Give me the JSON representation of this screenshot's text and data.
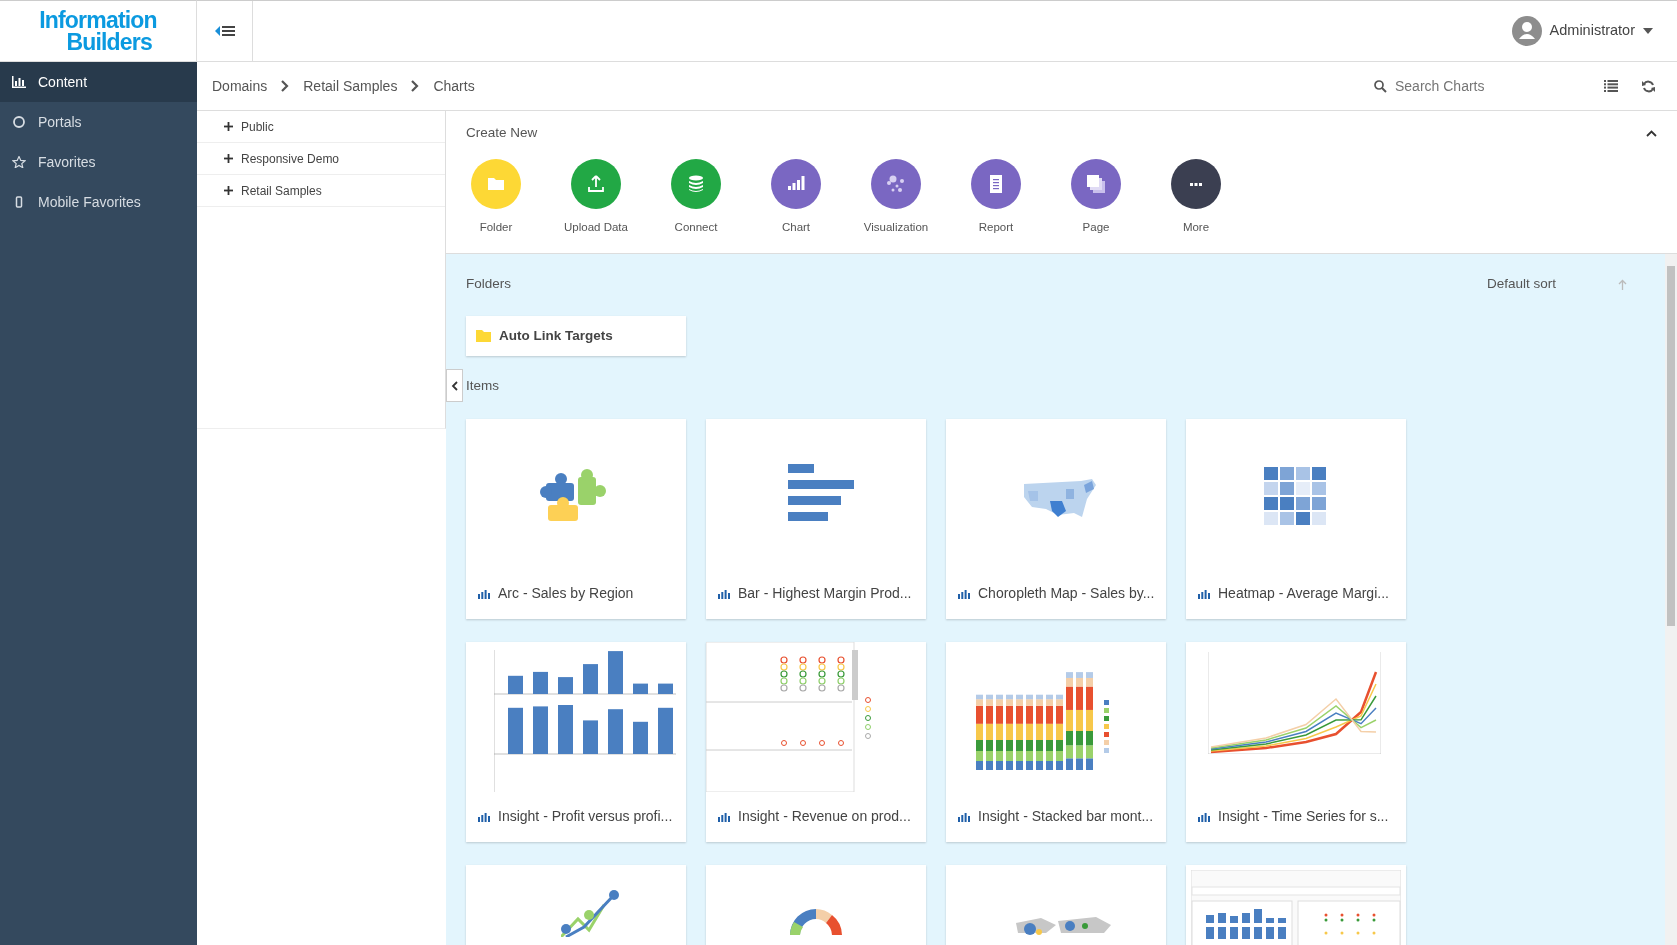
{
  "header": {
    "logo": [
      "Information",
      "Builders"
    ],
    "user": "Administrator"
  },
  "sidebar": {
    "items": [
      {
        "label": "Content",
        "kind": "chart",
        "selected": true
      },
      {
        "label": "Portals",
        "kind": "circle",
        "selected": false
      },
      {
        "label": "Favorites",
        "kind": "star",
        "selected": false
      },
      {
        "label": "Mobile Favorites",
        "kind": "mobile",
        "selected": false
      }
    ]
  },
  "breadcrumb": [
    "Domains",
    "Retail Samples",
    "Charts"
  ],
  "search": {
    "placeholder": "Search Charts"
  },
  "tree": [
    {
      "label": "Public",
      "expanded": false
    },
    {
      "label": "Responsive Demo",
      "expanded": false
    },
    {
      "label": "Retail Samples",
      "expanded": false
    }
  ],
  "create_new": {
    "title": "Create New",
    "expanded": true,
    "items": [
      {
        "label": "Folder",
        "kind": "folder",
        "color": "#fdd835"
      },
      {
        "label": "Upload Data",
        "kind": "upload",
        "color": "#22a845"
      },
      {
        "label": "Connect",
        "kind": "database",
        "color": "#22a845"
      },
      {
        "label": "Chart",
        "kind": "chart",
        "color": "#7a67c2"
      },
      {
        "label": "Visualization",
        "kind": "bubbles",
        "color": "#7a67c2"
      },
      {
        "label": "Report",
        "kind": "report",
        "color": "#7a67c2"
      },
      {
        "label": "Page",
        "kind": "page",
        "color": "#7a67c2"
      },
      {
        "label": "More",
        "kind": "more",
        "color": "#3b3f51"
      }
    ]
  },
  "folders": {
    "title": "Folders",
    "sort": "Default sort",
    "items": [
      {
        "label": "Auto Link Targets"
      }
    ]
  },
  "items": {
    "title": "Items",
    "cards": [
      {
        "label": "Arc - Sales by Region",
        "kind": "puzzle"
      },
      {
        "label": "Bar - Highest Margin Prod...",
        "kind": "hbar"
      },
      {
        "label": "Choropleth Map - Sales by...",
        "kind": "usmap"
      },
      {
        "label": "Heatmap - Average Margi...",
        "kind": "heatmap"
      },
      {
        "label": "Insight - Profit versus profi...",
        "kind": "dualbar"
      },
      {
        "label": "Insight - Revenue on prod...",
        "kind": "scatter"
      },
      {
        "label": "Insight - Stacked bar mont...",
        "kind": "stacked"
      },
      {
        "label": "Insight - Time Series for s...",
        "kind": "lines"
      },
      {
        "kind": "linedots"
      },
      {
        "kind": "donut"
      },
      {
        "kind": "worldmap"
      },
      {
        "kind": "dashboard"
      }
    ]
  }
}
